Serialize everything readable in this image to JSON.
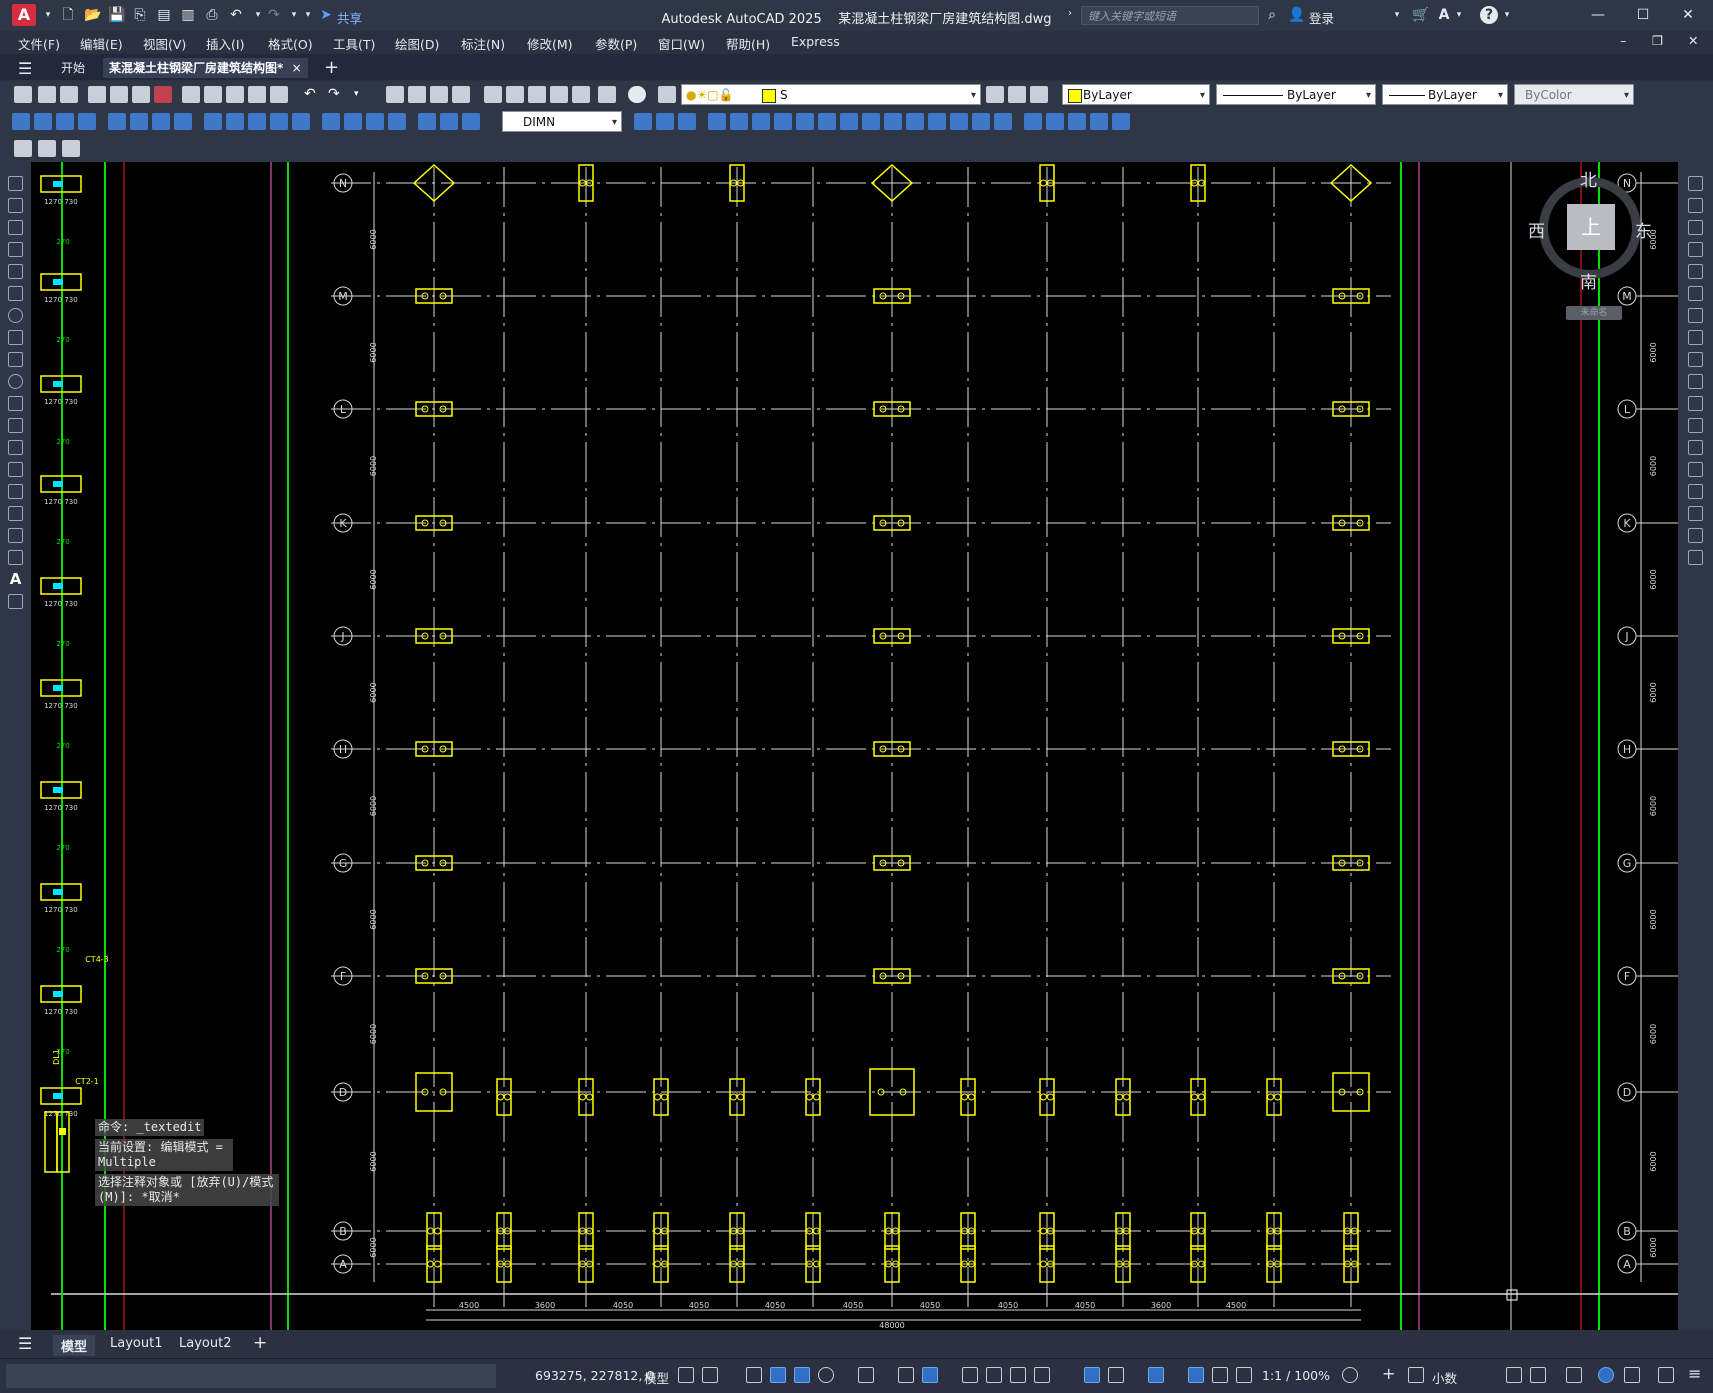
{
  "app": {
    "title": "Autodesk AutoCAD 2025",
    "document": "某混凝土柱钢梁厂房建筑结构图.dwg",
    "logo_letter": "A",
    "share_label": "共享",
    "search_placeholder": "键入关键字或短语",
    "login_label": "登录"
  },
  "menu": [
    "文件(F)",
    "编辑(E)",
    "视图(V)",
    "插入(I)",
    "格式(O)",
    "工具(T)",
    "绘图(D)",
    "标注(N)",
    "修改(M)",
    "参数(P)",
    "窗口(W)",
    "帮助(H)",
    "Express"
  ],
  "tabs": {
    "start": "开始",
    "active": "某混凝土柱钢梁厂房建筑结构图*",
    "close": "×",
    "add": "+"
  },
  "toolbar": {
    "layer_value": "S",
    "color_value": "ByLayer",
    "linetype_value": "ByLayer",
    "lineweight_value": "ByLayer",
    "plotstyle_value": "ByColor",
    "dimstyle_value": "DIMN"
  },
  "drawing": {
    "axis_rows": [
      "N",
      "M",
      "L",
      "K",
      "J",
      "H",
      "G",
      "F",
      "D",
      "B",
      "A"
    ],
    "bay_dims": [
      "4500",
      "3600",
      "4050",
      "4050",
      "4050",
      "4050",
      "4050",
      "4050",
      "4050",
      "3600",
      "4500"
    ],
    "total_width": "48000",
    "row_spacing_label": "6000",
    "left_dims": [
      "1270",
      "730"
    ],
    "pile_label": "270",
    "cap_labels": [
      "CT4-3",
      "CT2-1",
      "DL1"
    ],
    "ucs_label": "未命名"
  },
  "compass": {
    "north": "北",
    "south": "南",
    "east": "东",
    "west": "西",
    "top": "上"
  },
  "command": {
    "line1": "命令: _textedit",
    "line2": "当前设置: 编辑模式 = Multiple",
    "line3": "选择注释对象或 [放弃(U)/模式(M)]: *取消*"
  },
  "layout_tabs": [
    "模型",
    "Layout1",
    "Layout2"
  ],
  "status": {
    "coords": "693275, 227812, 0",
    "model": "模型",
    "scale": "1:1 / 100%",
    "units": "小数"
  },
  "colors": {
    "accent": "#2f6fc4",
    "background": "#000000",
    "green_line": "#00ff00",
    "yellow": "#ffff00",
    "red_line": "#ff0000",
    "magenta_line": "#ff66cc"
  }
}
